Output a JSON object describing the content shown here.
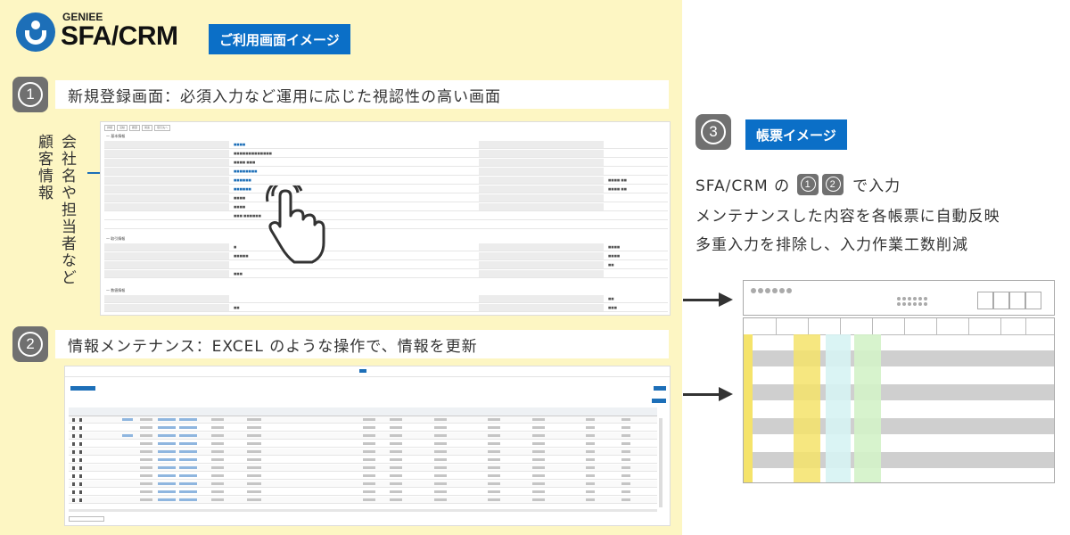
{
  "brand": {
    "sub": "GENIEE",
    "main": "SFA/CRM"
  },
  "tag_usage": "ご利用画面イメージ",
  "step1": {
    "num": "1",
    "text": "新規登録画面：必須入力など運用に応じた視認性の高い画面"
  },
  "step2": {
    "num": "2",
    "text": "情報メンテナンス：EXCEL のような操作で、情報を更新"
  },
  "step3": {
    "num": "3",
    "tag": "帳票イメージ"
  },
  "side_label": {
    "col1": "会社名や担当者など",
    "col2": "顧客情報"
  },
  "right_text": {
    "line1_pre": "SFA/CRM の",
    "line1_n1": "1",
    "line1_n2": "2",
    "line1_post": "で入力",
    "line2": "メンテナンスした内容を各帳票に自動反映",
    "line3": "多重入力を排除し、入力作業工数削減"
  },
  "colors": {
    "panel": "#fdf6c3",
    "accent": "#0b6fc7",
    "step": "#707070",
    "yellow": "#f5e36a",
    "cyan": "#d6f3f3",
    "green": "#d3f2c8"
  },
  "icons": [
    "hand-pointer-icon",
    "arrow-right-icon"
  ]
}
